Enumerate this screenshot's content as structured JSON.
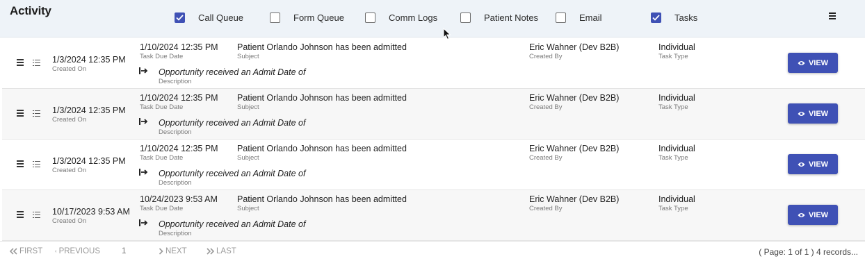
{
  "header": {
    "title": "Activity",
    "filters": [
      {
        "label": "Call Queue",
        "checked": true
      },
      {
        "label": "Form Queue",
        "checked": false
      },
      {
        "label": "Comm Logs",
        "checked": false
      },
      {
        "label": "Patient Notes",
        "checked": false
      },
      {
        "label": "Email",
        "checked": false
      },
      {
        "label": "Tasks",
        "checked": true
      }
    ],
    "menu_icon": "hamburger-icon"
  },
  "field_labels": {
    "created_on": "Created On",
    "due_date": "Task Due Date",
    "subject": "Subject",
    "description": "Description",
    "created_by": "Created By",
    "task_type": "Task Type"
  },
  "rows": [
    {
      "created_on": "1/3/2024 12:35 PM",
      "due_date": "1/10/2024 12:35 PM",
      "subject": "Patient Orlando Johnson has been admitted",
      "description": "Opportunity received an Admit Date of",
      "created_by": "Eric Wahner (Dev B2B)",
      "task_type": "Individual",
      "view_label": "VIEW"
    },
    {
      "created_on": "1/3/2024 12:35 PM",
      "due_date": "1/10/2024 12:35 PM",
      "subject": "Patient Orlando Johnson has been admitted",
      "description": "Opportunity received an Admit Date of",
      "created_by": "Eric Wahner (Dev B2B)",
      "task_type": "Individual",
      "view_label": "VIEW"
    },
    {
      "created_on": "1/3/2024 12:35 PM",
      "due_date": "1/10/2024 12:35 PM",
      "subject": "Patient Orlando Johnson has been admitted",
      "description": "Opportunity received an Admit Date of",
      "created_by": "Eric Wahner (Dev B2B)",
      "task_type": "Individual",
      "view_label": "VIEW"
    },
    {
      "created_on": "10/17/2023 9:53 AM",
      "due_date": "10/24/2023 9:53 AM",
      "subject": "Patient Orlando Johnson has been admitted",
      "description": "Opportunity received an Admit Date of",
      "created_by": "Eric Wahner (Dev B2B)",
      "task_type": "Individual",
      "view_label": "VIEW"
    }
  ],
  "pagination": {
    "first": "FIRST",
    "previous": "PREVIOUS",
    "page": "1",
    "next": "NEXT",
    "last": "LAST",
    "info": "( Page: 1 of 1 ) 4 records..."
  },
  "colors": {
    "accent": "#3f51b5",
    "header_bg": "#eef3f8"
  }
}
